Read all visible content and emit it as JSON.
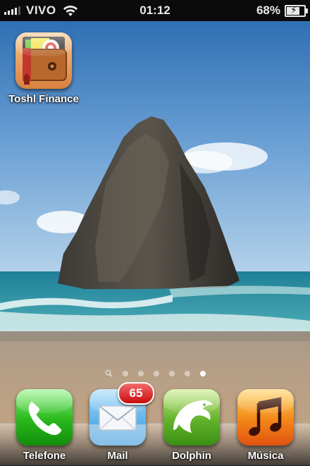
{
  "status_bar": {
    "carrier": "VIVO",
    "time": "01:12",
    "battery_percent": "68%",
    "battery_level": 0.68,
    "signal_bars": 4
  },
  "home": {
    "apps": [
      {
        "label": "Toshl Finance",
        "icon": "wallet-icon"
      }
    ]
  },
  "page_indicator": {
    "pages": 6,
    "current_page": 6,
    "has_search_page": true
  },
  "dock": {
    "apps": [
      {
        "label": "Telefone",
        "icon": "phone-icon"
      },
      {
        "label": "Mail",
        "icon": "envelope-icon",
        "badge": "65"
      },
      {
        "label": "Dolphin",
        "icon": "dolphin-icon"
      },
      {
        "label": "Música",
        "icon": "music-note-icon"
      }
    ]
  },
  "colors": {
    "badge": "#d11a1a",
    "phone": "#2bb81f",
    "mail": "#2f95df",
    "dolphin": "#62b22c",
    "music": "#f28718"
  }
}
